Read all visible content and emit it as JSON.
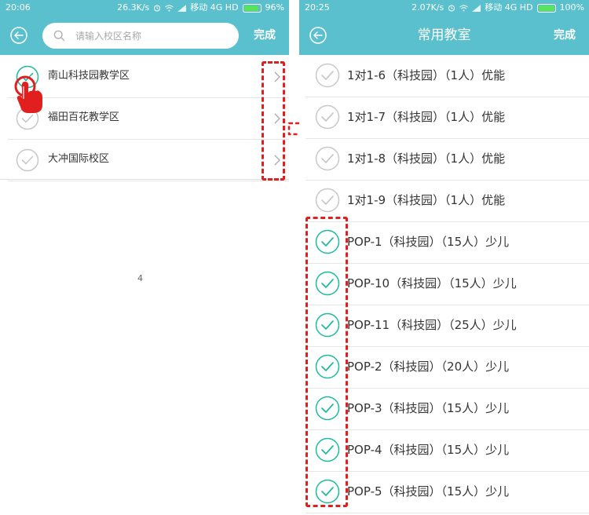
{
  "colors": {
    "accent": "#5bc0cd",
    "check_active": "#1abc9c",
    "check_inactive": "#c8c8c8",
    "annotation": "#e11f1f"
  },
  "left": {
    "status": {
      "time": "20:06",
      "speed": "26.3K/s",
      "carrier": "移动 4G HD",
      "battery": "96%",
      "battery_level": 0.96
    },
    "search": {
      "placeholder": "请输入校区名称"
    },
    "done_label": "完成",
    "campuses": [
      {
        "label": "南山科技园教学区",
        "checked": true
      },
      {
        "label": "福田百花教学区",
        "checked": false
      },
      {
        "label": "大冲国际校区",
        "checked": false
      }
    ],
    "page_number": "4",
    "icons": {
      "back": "back-arrow-icon",
      "search": "search-icon",
      "chevron": "chevron-right-icon",
      "hand": "hand-pointer-icon"
    }
  },
  "right": {
    "status": {
      "time": "20:25",
      "speed": "2.07K/s",
      "carrier": "移动 4G HD",
      "battery": "100%",
      "battery_level": 1.0
    },
    "title": "常用教室",
    "done_label": "完成",
    "classrooms": [
      {
        "label": "1对1-6（科技园）（1人）优能",
        "checked": false
      },
      {
        "label": "1对1-7（科技园）（1人）优能",
        "checked": false
      },
      {
        "label": "1对1-8（科技园）（1人）优能",
        "checked": false
      },
      {
        "label": "1对1-9（科技园）（1人）优能",
        "checked": false
      },
      {
        "label": "POP-1（科技园）（15人）少儿",
        "checked": true
      },
      {
        "label": "POP-10（科技园）（15人）少儿",
        "checked": true
      },
      {
        "label": "POP-11（科技园）（25人）少儿",
        "checked": true
      },
      {
        "label": "POP-2（科技园）（20人）少儿",
        "checked": true
      },
      {
        "label": "POP-3（科技园）（15人）少儿",
        "checked": true
      },
      {
        "label": "POP-4（科技园）（15人）少儿",
        "checked": true
      },
      {
        "label": "POP-5（科技园）（15人）少儿",
        "checked": true
      }
    ],
    "icons": {
      "back": "back-arrow-icon",
      "check": "check-circle-icon"
    }
  }
}
